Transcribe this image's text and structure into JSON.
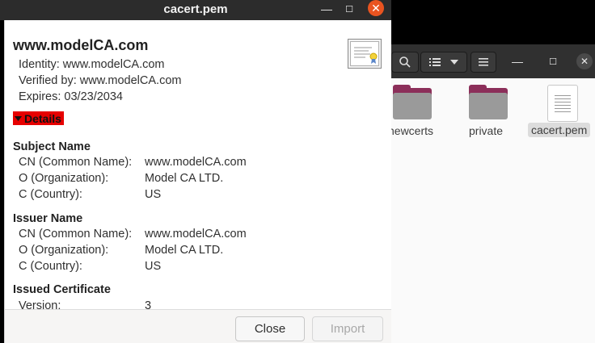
{
  "dialog": {
    "title": "cacert.pem",
    "window_buttons": {
      "minimize": "—",
      "maximize": "☐",
      "close": "✕"
    },
    "cert_name": "www.modelCA.com",
    "identity": "Identity: www.modelCA.com",
    "verified_by": "Verified by: www.modelCA.com",
    "expires": "Expires: 03/23/2034",
    "details_label": "Details",
    "subject": {
      "heading": "Subject Name",
      "rows": [
        {
          "label": "CN (Common Name):",
          "value": "www.modelCA.com"
        },
        {
          "label": "O (Organization):",
          "value": "Model CA LTD."
        },
        {
          "label": "C (Country):",
          "value": "US"
        }
      ]
    },
    "issuer": {
      "heading": "Issuer Name",
      "rows": [
        {
          "label": "CN (Common Name):",
          "value": "www.modelCA.com"
        },
        {
          "label": "O (Organization):",
          "value": "Model CA LTD."
        },
        {
          "label": "C (Country):",
          "value": "US"
        }
      ]
    },
    "issued": {
      "heading": "Issued Certificate",
      "rows": [
        {
          "label": "Version:",
          "value": "3"
        }
      ]
    },
    "buttons": {
      "close": "Close",
      "import": "Import"
    },
    "accent_color": "#e95420",
    "details_highlight": "#e60000"
  },
  "file_manager": {
    "window_buttons": {
      "minimize": "—",
      "maximize": "☐",
      "close": "✕"
    },
    "items": [
      {
        "name": "newcerts",
        "icon": "folder-icon"
      },
      {
        "name": "private",
        "icon": "folder-icon"
      },
      {
        "name": "cacert.pem",
        "icon": "text-file-icon",
        "selected": true
      }
    ]
  }
}
